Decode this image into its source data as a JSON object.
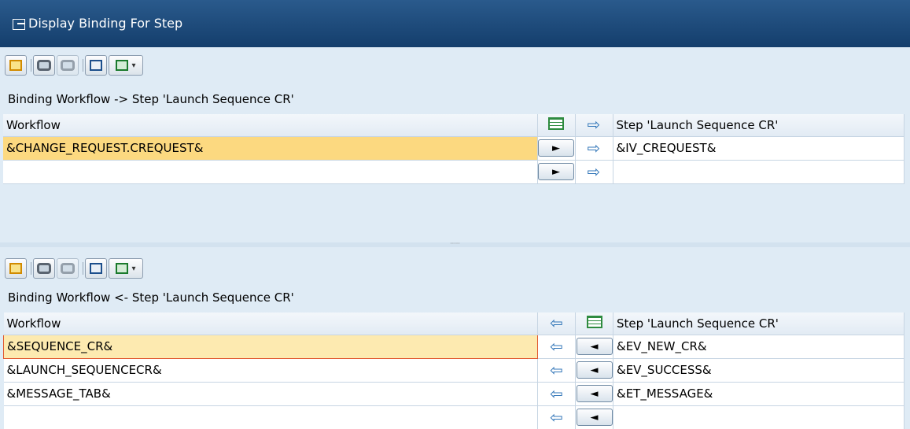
{
  "window": {
    "title": "Display Binding For Step"
  },
  "upper": {
    "caption": "Binding Workflow  -> Step 'Launch Sequence CR'",
    "headers": {
      "left": "Workflow",
      "right": "Step 'Launch Sequence CR'"
    },
    "rows": [
      {
        "left": "&CHANGE_REQUEST.CREQUEST&",
        "right": "&IV_CREQUEST&"
      },
      {
        "left": "",
        "right": ""
      }
    ]
  },
  "lower": {
    "caption": "Binding Workflow  <- Step 'Launch Sequence CR'",
    "headers": {
      "left": "Workflow",
      "right": "Step 'Launch Sequence CR'"
    },
    "rows": [
      {
        "left": "&SEQUENCE_CR&",
        "right": "&EV_NEW_CR&"
      },
      {
        "left": "&LAUNCH_SEQUENCECR&",
        "right": "&EV_SUCCESS&"
      },
      {
        "left": "&MESSAGE_TAB&",
        "right": "&ET_MESSAGE&"
      },
      {
        "left": "",
        "right": ""
      }
    ]
  },
  "icons": {
    "toolbar": [
      "tree-icon",
      "find-icon",
      "find-next-icon",
      "print-icon",
      "export-icon"
    ],
    "arrow_right": "►",
    "arrow_left": "◄",
    "flow_right": "⇨",
    "flow_left": "⇦"
  },
  "colors": {
    "title_bar": "#1e4c7e",
    "selected_cell": "#fcd980",
    "focus_border": "#e05830",
    "arrow_blue": "#3276b8"
  }
}
